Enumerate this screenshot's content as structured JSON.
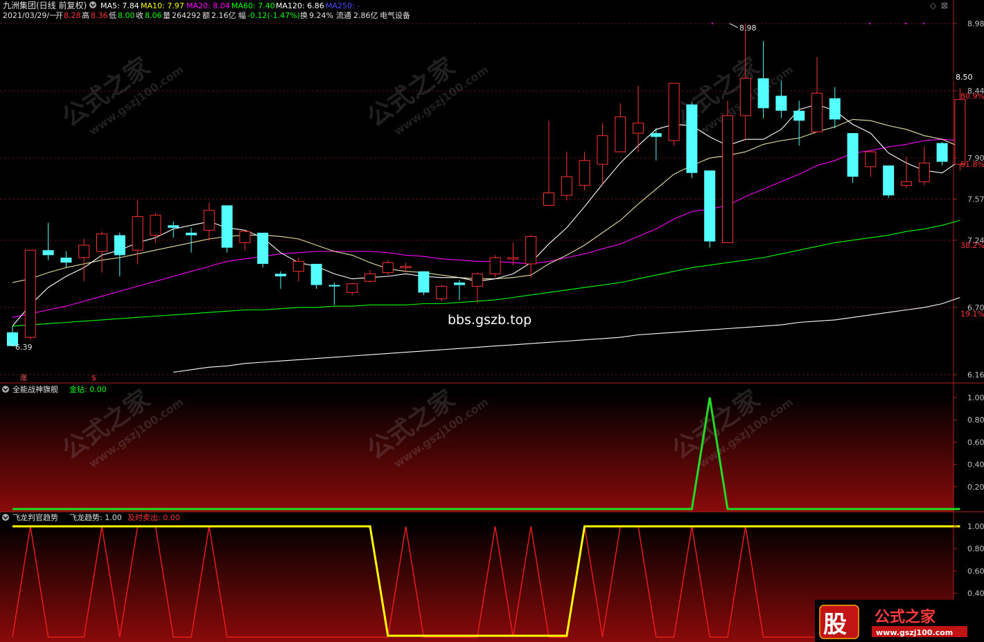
{
  "header": {
    "stock": "九洲集团(日线 前复权)",
    "ma5": "MA5: 7.84",
    "ma10": "MA10: 7.97",
    "ma20": "MA20: 8.04",
    "ma60": "MA60: 7.40",
    "ma120": "MA120: 6.86",
    "ma250": "MA250: -",
    "date": "2021/03/29/一",
    "open_label": "开",
    "open": "8.28",
    "high_label": "高",
    "high": "8.36",
    "low_label": "低",
    "low": "8.00",
    "close_label": "收",
    "close": "8.06",
    "vol_label": "量",
    "vol": "264292",
    "amt_label": "额",
    "amt": "2.16亿",
    "chg_label": "幅",
    "chg": "-0.12(-1.47%)",
    "turn_label": "换",
    "turn": "9.24%",
    "float_label": "流通",
    "float": "2.86亿",
    "sector": "电气设备"
  },
  "colors": {
    "up": "#ff3232",
    "down": "#54ffff",
    "ma5": "#ffffff",
    "ma10": "#ffff00",
    "ma20": "#ff00ff",
    "ma60": "#00ff00",
    "ma120": "#ffffff",
    "ma250": "#0000ff",
    "grid": "#7a1a1a",
    "axis_text": "#c0c0c0",
    "gold": "#ffff00"
  },
  "annotations": {
    "peak": "8.98",
    "trough": "6.39",
    "watermark_site": "bbs.gszb.top",
    "watermark_cn": "公式之家",
    "watermark_url": "www.gszj100.com",
    "zhang": "涨",
    "dollar": "$",
    "price_marker": "8.50"
  },
  "panels": {
    "main": {
      "y_ticks": [
        "8.98",
        "8.44",
        "7.90",
        "7.57",
        "7.24",
        "6.70",
        "6.16"
      ],
      "pct_ticks": [
        "80.9%",
        "61.8%",
        "38.2%",
        "19.1%"
      ]
    },
    "p2": {
      "title": "全能战神旗舰",
      "series_label": "金钻: 0.00",
      "y_ticks": [
        "1.00",
        "0.80",
        "0.60",
        "0.40",
        "0.20"
      ]
    },
    "p3": {
      "title": "飞龙判官趋势",
      "series1_label": "飞龙趋势: 1.00",
      "series2_label": "及时卖出: 0.00",
      "y_ticks": [
        "1.00",
        "0.80",
        "0.60",
        "0.40"
      ]
    }
  },
  "logo": {
    "char": "股",
    "text": "公式之家",
    "url": "www.gszj100.com"
  },
  "chart_data": [
    {
      "type": "candlestick",
      "candles": [
        {
          "o": 6.5,
          "c": 6.39,
          "h": 6.55,
          "l": 6.39
        },
        {
          "o": 6.46,
          "c": 7.16,
          "h": 7.16,
          "l": 6.44
        },
        {
          "o": 7.16,
          "c": 7.12,
          "h": 7.38,
          "l": 7.08
        },
        {
          "o": 7.1,
          "c": 7.06,
          "h": 7.15,
          "l": 7.02
        },
        {
          "o": 7.1,
          "c": 7.2,
          "h": 7.25,
          "l": 6.91
        },
        {
          "o": 7.15,
          "c": 7.29,
          "h": 7.31,
          "l": 6.98
        },
        {
          "o": 7.28,
          "c": 7.12,
          "h": 7.3,
          "l": 6.95
        },
        {
          "o": 7.16,
          "c": 7.43,
          "h": 7.56,
          "l": 7.05
        },
        {
          "o": 7.28,
          "c": 7.44,
          "h": 7.46,
          "l": 7.22
        },
        {
          "o": 7.36,
          "c": 7.34,
          "h": 7.39,
          "l": 7.26
        },
        {
          "o": 7.3,
          "c": 7.28,
          "h": 7.34,
          "l": 7.14
        },
        {
          "o": 7.32,
          "c": 7.48,
          "h": 7.54,
          "l": 7.24
        },
        {
          "o": 7.52,
          "c": 7.18,
          "h": 7.52,
          "l": 7.14
        },
        {
          "o": 7.22,
          "c": 7.31,
          "h": 7.32,
          "l": 7.16
        },
        {
          "o": 7.3,
          "c": 7.05,
          "h": 7.3,
          "l": 7.02
        },
        {
          "o": 6.97,
          "c": 6.95,
          "h": 6.99,
          "l": 6.85
        },
        {
          "o": 6.99,
          "c": 7.07,
          "h": 7.1,
          "l": 6.91
        },
        {
          "o": 7.05,
          "c": 6.88,
          "h": 7.05,
          "l": 6.85
        },
        {
          "o": 6.88,
          "c": 6.87,
          "h": 6.9,
          "l": 6.72
        },
        {
          "o": 6.82,
          "c": 6.89,
          "h": 6.9,
          "l": 6.8
        },
        {
          "o": 6.91,
          "c": 6.97,
          "h": 7.0,
          "l": 6.9
        },
        {
          "o": 6.98,
          "c": 7.06,
          "h": 7.08,
          "l": 6.96
        },
        {
          "o": 7.03,
          "c": 7.03,
          "h": 7.06,
          "l": 6.98
        },
        {
          "o": 6.99,
          "c": 6.82,
          "h": 6.99,
          "l": 6.8
        },
        {
          "o": 6.77,
          "c": 6.87,
          "h": 6.88,
          "l": 6.75
        },
        {
          "o": 6.9,
          "c": 6.88,
          "h": 6.92,
          "l": 6.76
        },
        {
          "o": 6.87,
          "c": 6.97,
          "h": 6.98,
          "l": 6.74
        },
        {
          "o": 6.97,
          "c": 7.1,
          "h": 7.12,
          "l": 6.94
        },
        {
          "o": 7.1,
          "c": 7.1,
          "h": 7.22,
          "l": 7.04
        },
        {
          "o": 7.05,
          "c": 7.27,
          "h": 7.28,
          "l": 6.94
        },
        {
          "o": 7.52,
          "c": 7.62,
          "h": 8.2,
          "l": 7.52
        },
        {
          "o": 7.6,
          "c": 7.75,
          "h": 7.95,
          "l": 7.56
        },
        {
          "o": 7.68,
          "c": 7.88,
          "h": 7.95,
          "l": 7.64
        },
        {
          "o": 7.85,
          "c": 8.08,
          "h": 8.18,
          "l": 7.68
        },
        {
          "o": 7.95,
          "c": 8.23,
          "h": 8.34,
          "l": 7.95
        },
        {
          "o": 8.1,
          "c": 8.18,
          "h": 8.48,
          "l": 7.95
        },
        {
          "o": 8.1,
          "c": 8.07,
          "h": 8.14,
          "l": 7.88
        },
        {
          "o": 8.04,
          "c": 8.5,
          "h": 8.5,
          "l": 8.0
        },
        {
          "o": 8.33,
          "c": 7.78,
          "h": 8.35,
          "l": 7.74
        },
        {
          "o": 7.8,
          "c": 7.23,
          "h": 7.8,
          "l": 7.18
        },
        {
          "o": 7.22,
          "c": 8.24,
          "h": 8.36,
          "l": 7.22
        },
        {
          "o": 8.24,
          "c": 8.54,
          "h": 8.98,
          "l": 8.04
        },
        {
          "o": 8.54,
          "c": 8.3,
          "h": 8.84,
          "l": 8.22
        },
        {
          "o": 8.4,
          "c": 8.28,
          "h": 8.52,
          "l": 8.22
        },
        {
          "o": 8.28,
          "c": 8.2,
          "h": 8.36,
          "l": 8.0
        },
        {
          "o": 8.11,
          "c": 8.42,
          "h": 8.71,
          "l": 8.11
        },
        {
          "o": 8.38,
          "c": 8.21,
          "h": 8.47,
          "l": 8.14
        },
        {
          "o": 8.1,
          "c": 7.75,
          "h": 8.1,
          "l": 7.7
        },
        {
          "o": 7.83,
          "c": 7.95,
          "h": 7.96,
          "l": 7.75
        },
        {
          "o": 7.84,
          "c": 7.6,
          "h": 7.84,
          "l": 7.58
        },
        {
          "o": 7.68,
          "c": 7.71,
          "h": 7.91,
          "l": 7.66
        },
        {
          "o": 7.71,
          "c": 7.86,
          "h": 7.99,
          "l": 7.68
        },
        {
          "o": 8.02,
          "c": 7.87,
          "h": 8.03,
          "l": 7.84
        },
        {
          "o": 7.85,
          "c": 8.37,
          "h": 8.46,
          "l": 7.8
        }
      ],
      "ma5": [
        6.55,
        6.72,
        6.86,
        6.95,
        7.02,
        7.12,
        7.16,
        7.22,
        7.26,
        7.33,
        7.36,
        7.39,
        7.34,
        7.32,
        7.26,
        7.14,
        7.06,
        7.03,
        6.97,
        6.93,
        6.94,
        6.95,
        6.97,
        6.95,
        6.94,
        6.94,
        6.91,
        6.93,
        6.97,
        7.06,
        7.21,
        7.34,
        7.51,
        7.69,
        7.86,
        8.0,
        8.13,
        8.17,
        8.16,
        8.07,
        8.0,
        8.05,
        8.05,
        8.13,
        8.29,
        8.33,
        8.28,
        8.17,
        8.1,
        7.94,
        7.86,
        7.8,
        7.78,
        7.88
      ],
      "ma10": [
        6.9,
        6.93,
        6.98,
        7.02,
        7.05,
        7.08,
        7.1,
        7.13,
        7.16,
        7.19,
        7.22,
        7.25,
        7.27,
        7.28,
        7.28,
        7.27,
        7.25,
        7.2,
        7.15,
        7.12,
        7.06,
        7.01,
        6.99,
        6.98,
        6.96,
        6.94,
        6.93,
        6.93,
        6.94,
        6.96,
        7.05,
        7.12,
        7.2,
        7.3,
        7.4,
        7.53,
        7.65,
        7.77,
        7.84,
        7.9,
        7.92,
        7.95,
        8.01,
        8.04,
        8.06,
        8.11,
        8.15,
        8.21,
        8.2,
        8.16,
        8.13,
        8.08,
        8.05,
        7.99
      ],
      "ma20": [
        6.62,
        6.65,
        6.68,
        6.71,
        6.75,
        6.79,
        6.83,
        6.87,
        6.91,
        6.95,
        6.99,
        7.03,
        7.07,
        7.09,
        7.11,
        7.13,
        7.14,
        7.15,
        7.15,
        7.15,
        7.15,
        7.14,
        7.12,
        7.11,
        7.09,
        7.08,
        7.07,
        7.07,
        7.06,
        7.05,
        7.07,
        7.1,
        7.13,
        7.17,
        7.21,
        7.27,
        7.33,
        7.41,
        7.47,
        7.49,
        7.52,
        7.59,
        7.65,
        7.71,
        7.77,
        7.84,
        7.88,
        7.94,
        7.96,
        7.99,
        8.01,
        8.04,
        8.05,
        8.04
      ],
      "ma60": [
        6.55,
        6.56,
        6.57,
        6.58,
        6.59,
        6.6,
        6.61,
        6.62,
        6.63,
        6.64,
        6.65,
        6.66,
        6.67,
        6.68,
        6.68,
        6.69,
        6.7,
        6.7,
        6.71,
        6.71,
        6.72,
        6.72,
        6.72,
        6.73,
        6.73,
        6.74,
        6.75,
        6.76,
        6.78,
        6.8,
        6.82,
        6.84,
        6.86,
        6.88,
        6.9,
        6.93,
        6.96,
        6.99,
        7.02,
        7.04,
        7.06,
        7.08,
        7.1,
        7.13,
        7.16,
        7.19,
        7.22,
        7.24,
        7.26,
        7.28,
        7.31,
        7.33,
        7.36,
        7.4
      ],
      "ma120": [
        null,
        null,
        null,
        null,
        null,
        null,
        null,
        null,
        null,
        6.18,
        6.2,
        6.22,
        6.23,
        6.25,
        6.26,
        6.27,
        6.28,
        6.29,
        6.3,
        6.31,
        6.32,
        6.33,
        6.34,
        6.35,
        6.36,
        6.37,
        6.38,
        6.39,
        6.4,
        6.41,
        6.42,
        6.43,
        6.44,
        6.45,
        6.46,
        6.48,
        6.49,
        6.5,
        6.51,
        6.52,
        6.53,
        6.54,
        6.55,
        6.56,
        6.58,
        6.59,
        6.6,
        6.62,
        6.64,
        6.66,
        6.68,
        6.7,
        6.73,
        6.78
      ]
    },
    {
      "type": "line",
      "name": "金钻",
      "values": [
        0,
        0,
        0,
        0,
        0,
        0,
        0,
        0,
        0,
        0,
        0,
        0,
        0,
        0,
        0,
        0,
        0,
        0,
        0,
        0,
        0,
        0,
        0,
        0,
        0,
        0,
        0,
        0,
        0,
        0,
        0,
        0,
        0,
        0,
        0,
        0,
        0,
        0,
        0,
        1,
        0,
        0,
        0,
        0,
        0,
        0,
        0,
        0,
        0,
        0,
        0,
        0,
        0,
        0
      ],
      "ylim": [
        0,
        1
      ]
    },
    {
      "type": "line",
      "series": [
        {
          "name": "飞龙趋势",
          "values": [
            1,
            1,
            1,
            1,
            1,
            1,
            1,
            1,
            1,
            1,
            1,
            1,
            1,
            1,
            1,
            1,
            1,
            1,
            1,
            1,
            1,
            0,
            0,
            0,
            0,
            0,
            0,
            0,
            0,
            0,
            0,
            0,
            1,
            1,
            1,
            1,
            1,
            1,
            1,
            1,
            1,
            1,
            1,
            1,
            1,
            1,
            1,
            1,
            1,
            1,
            1,
            1,
            1,
            1
          ]
        },
        {
          "name": "及时卖出",
          "values": [
            0,
            1,
            0,
            0,
            0,
            1,
            0,
            1,
            1,
            0,
            0,
            1,
            0,
            0,
            0,
            0,
            0,
            0,
            0,
            0,
            0,
            0,
            1,
            0,
            0,
            0,
            0,
            1,
            0,
            1,
            0,
            0,
            1,
            0,
            1,
            1,
            0,
            0,
            1,
            0,
            0,
            1,
            0,
            0,
            0,
            0,
            0,
            0,
            0,
            0,
            0,
            0,
            0,
            0
          ]
        }
      ],
      "ylim": [
        0.3,
        1
      ]
    }
  ]
}
